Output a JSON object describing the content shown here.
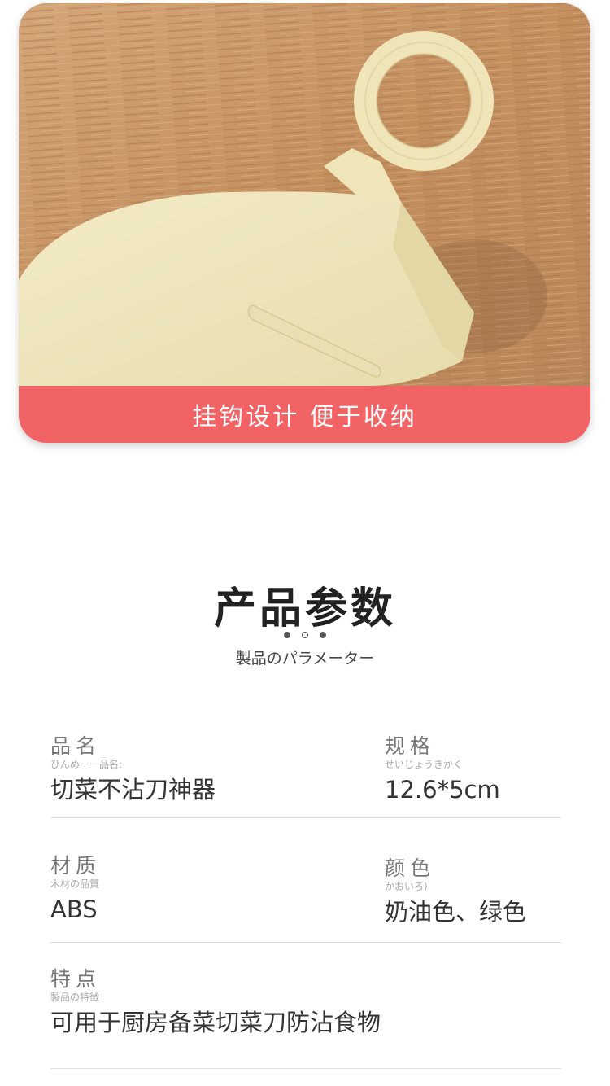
{
  "hero": {
    "banner_text": "挂钩设计 便于收纳",
    "colors": {
      "banner": "#f26366",
      "product": "#efe6bd",
      "wood": "#c99869"
    }
  },
  "section": {
    "title": "产品参数",
    "subtitle": "製品のパラメーター"
  },
  "params": {
    "name": {
      "label": "品名",
      "ruby": "ひんめーー品名:",
      "value": "切菜不沾刀神器"
    },
    "size": {
      "label": "规格",
      "ruby": "せいじょうきかく",
      "value": "12.6*5cm"
    },
    "material": {
      "label": "材质",
      "ruby": "木材の品質",
      "value": "ABS"
    },
    "color": {
      "label": "颜色",
      "ruby": "かおいろ)",
      "value": "奶油色、绿色"
    },
    "feature": {
      "label": "特点",
      "ruby": "製品の特徴",
      "value": "可用于厨房备菜切菜刀防沾食物"
    }
  }
}
